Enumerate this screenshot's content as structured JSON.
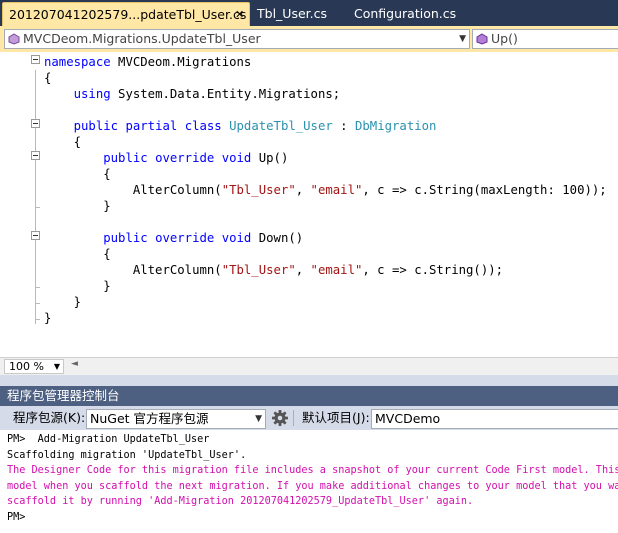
{
  "tabs": [
    {
      "label": "201207041202579...pdateTbl_User.cs",
      "close": "✕",
      "active": true
    },
    {
      "label": "Tbl_User.cs",
      "active": false
    },
    {
      "label": "Configuration.cs",
      "active": false
    }
  ],
  "navbar": {
    "type_selector": "MVCDeom.Migrations.UpdateTbl_User",
    "member_selector": "Up()"
  },
  "code_lines": [
    [
      {
        "t": "namespace",
        "c": "kw"
      },
      {
        "t": " MVCDeom.Migrations"
      }
    ],
    [
      {
        "t": "{"
      }
    ],
    [
      {
        "t": "    "
      },
      {
        "t": "using",
        "c": "kw"
      },
      {
        "t": " System.Data.Entity.Migrations;"
      }
    ],
    [
      {
        "t": ""
      }
    ],
    [
      {
        "t": "    "
      },
      {
        "t": "public",
        "c": "kw"
      },
      {
        "t": " "
      },
      {
        "t": "partial",
        "c": "kw"
      },
      {
        "t": " "
      },
      {
        "t": "class",
        "c": "kw"
      },
      {
        "t": " "
      },
      {
        "t": "UpdateTbl_User",
        "c": "ty"
      },
      {
        "t": " : "
      },
      {
        "t": "DbMigration",
        "c": "ty"
      }
    ],
    [
      {
        "t": "    {"
      }
    ],
    [
      {
        "t": "        "
      },
      {
        "t": "public",
        "c": "kw"
      },
      {
        "t": " "
      },
      {
        "t": "override",
        "c": "kw"
      },
      {
        "t": " "
      },
      {
        "t": "void",
        "c": "kw"
      },
      {
        "t": " Up()"
      }
    ],
    [
      {
        "t": "        {"
      }
    ],
    [
      {
        "t": "            AlterColumn("
      },
      {
        "t": "\"Tbl_User\"",
        "c": "st"
      },
      {
        "t": ", "
      },
      {
        "t": "\"email\"",
        "c": "st"
      },
      {
        "t": ", c => c.String(maxLength: 100));"
      }
    ],
    [
      {
        "t": "        }"
      }
    ],
    [
      {
        "t": ""
      }
    ],
    [
      {
        "t": "        "
      },
      {
        "t": "public",
        "c": "kw"
      },
      {
        "t": " "
      },
      {
        "t": "override",
        "c": "kw"
      },
      {
        "t": " "
      },
      {
        "t": "void",
        "c": "kw"
      },
      {
        "t": " Down()"
      }
    ],
    [
      {
        "t": "        {"
      }
    ],
    [
      {
        "t": "            AlterColumn("
      },
      {
        "t": "\"Tbl_User\"",
        "c": "st"
      },
      {
        "t": ", "
      },
      {
        "t": "\"email\"",
        "c": "st"
      },
      {
        "t": ", c => c.String());"
      }
    ],
    [
      {
        "t": "        }"
      }
    ],
    [
      {
        "t": "    }"
      }
    ],
    [
      {
        "t": "}"
      }
    ]
  ],
  "zoom": {
    "value": "100 %"
  },
  "console": {
    "title": "程序包管理器控制台",
    "source_label": "程序包源(K):",
    "source_value": "NuGet 官方程序包源",
    "default_project_label": "默认项目(J):",
    "default_project_value": "MVCDemo",
    "output_lines": [
      {
        "text": "PM>  Add-Migration UpdateTbl_User",
        "color": "normal"
      },
      {
        "text": "Scaffolding migration 'UpdateTbl_User'.",
        "color": "normal"
      },
      {
        "text": "The Designer Code for this migration file includes a snapshot of your current Code First model. This s",
        "color": "magenta"
      },
      {
        "text": "model when you scaffold the next migration. If you make additional changes to your model that you want",
        "color": "magenta"
      },
      {
        "text": "scaffold it by running 'Add-Migration 201207041202579_UpdateTbl_User' again.",
        "color": "magenta"
      },
      {
        "text": "PM>",
        "color": "normal"
      }
    ]
  },
  "colors": {
    "keyword": "#0000ff",
    "type": "#2b91af",
    "string": "#a31515",
    "warning": "#d20fae",
    "tab_active": "#ffe8a6",
    "tabstrip": "#293955"
  }
}
